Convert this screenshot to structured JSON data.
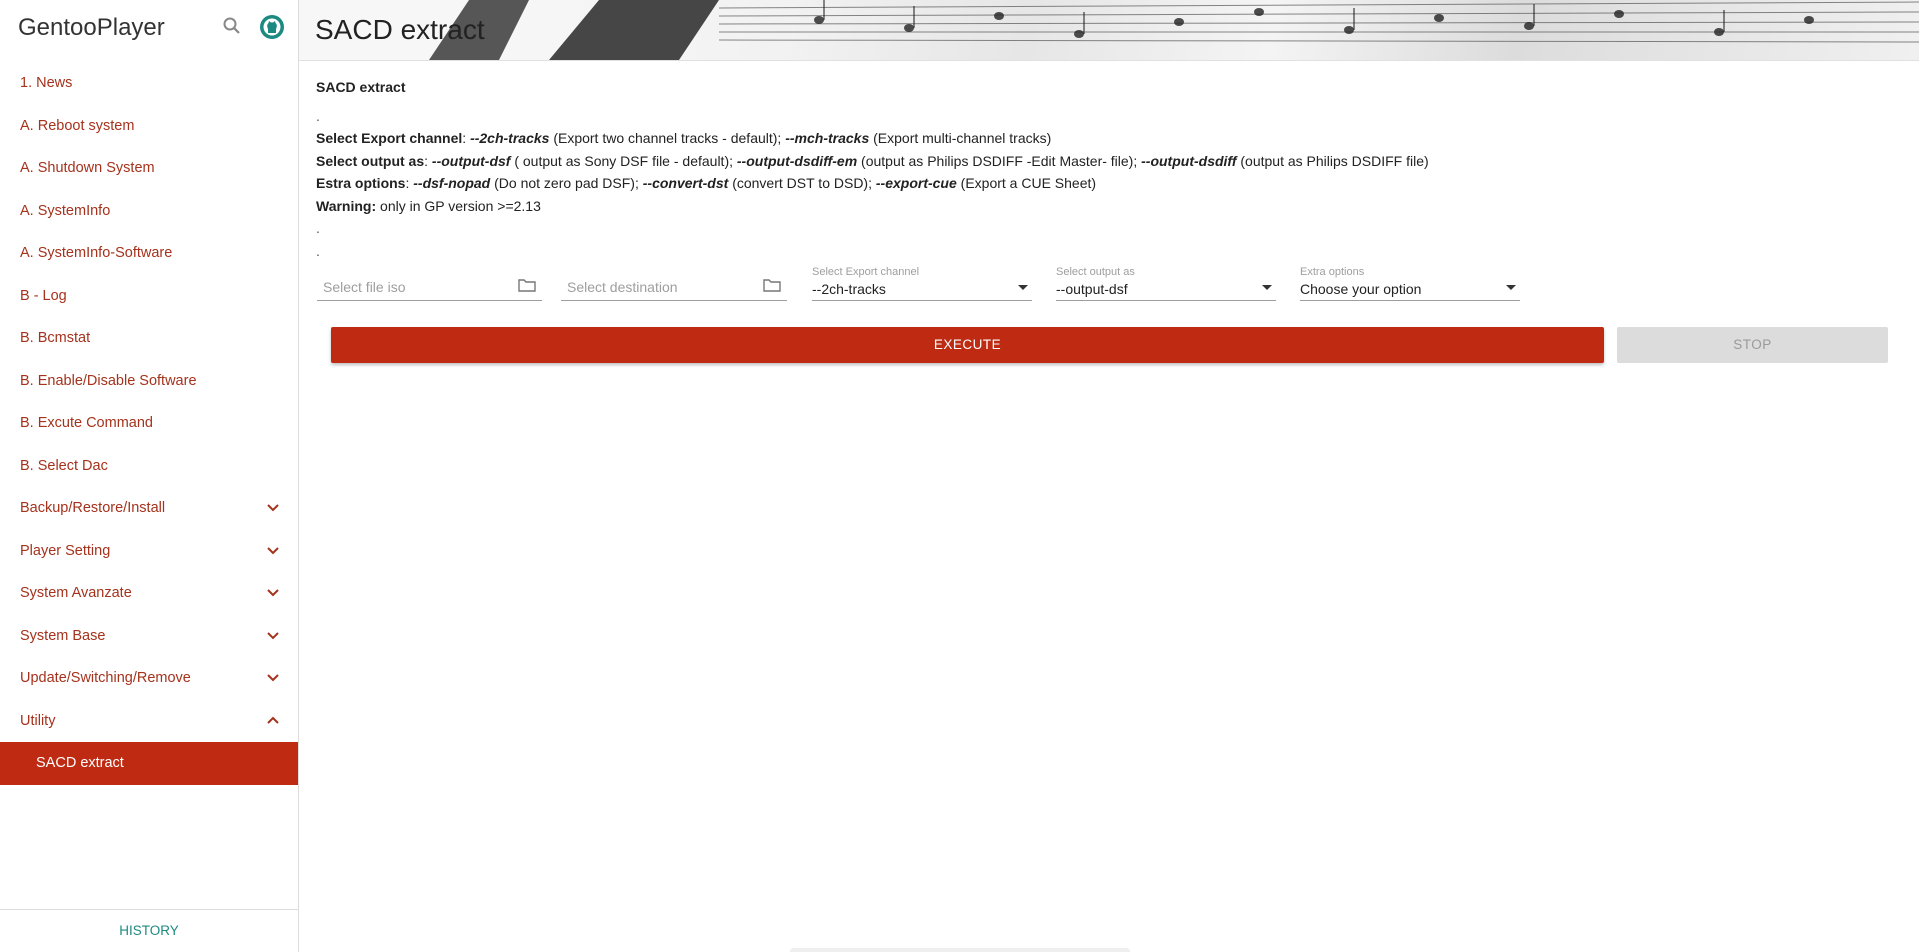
{
  "app": {
    "name": "GentooPlayer",
    "search_icon": "search-icon",
    "github_icon": "github-icon"
  },
  "sidebar": {
    "items": [
      {
        "label": "1. News"
      },
      {
        "label": "A. Reboot system"
      },
      {
        "label": "A. Shutdown System"
      },
      {
        "label": "A. SystemInfo"
      },
      {
        "label": "A. SystemInfo-Software"
      },
      {
        "label": "B - Log"
      },
      {
        "label": "B. Bcmstat"
      },
      {
        "label": "B. Enable/Disable Software"
      },
      {
        "label": "B. Excute Command"
      },
      {
        "label": "B. Select Dac"
      },
      {
        "label": "Backup/Restore/Install",
        "chevron": "chevron-down-icon"
      },
      {
        "label": "Player Setting",
        "chevron": "chevron-down-icon"
      },
      {
        "label": "System Avanzate",
        "chevron": "chevron-down-icon"
      },
      {
        "label": "System Base",
        "chevron": "chevron-down-icon"
      },
      {
        "label": "Update/Switching/Remove",
        "chevron": "chevron-down-icon"
      },
      {
        "label": "Utility",
        "chevron": "chevron-up-icon"
      },
      {
        "label": "SACD extract",
        "active": true
      }
    ],
    "footer_label": "HISTORY"
  },
  "header": {
    "title": "SACD extract"
  },
  "main": {
    "heading": "SACD extract",
    "dot": ".",
    "line1": {
      "label": "Select Export channel",
      "opt1": "--2ch-tracks",
      "desc1": " (Export two channel tracks - default); ",
      "opt2": "--mch-tracks",
      "desc2": " (Export multi-channel tracks)"
    },
    "line2": {
      "label": "Select output as",
      "opt1": "--output-dsf",
      "desc1": " ( output as Sony DSF file - default); ",
      "opt2": "--output-dsdiff-em",
      "desc2": " (output as Philips DSDIFF -Edit Master- file); ",
      "opt3": "--output-dsdiff",
      "desc3": " (output as Philips DSDIFF file)"
    },
    "line3": {
      "label": "Estra options",
      "opt1": "--dsf-nopad",
      "desc1": " (Do not zero pad DSF); ",
      "opt2": "--convert-dst",
      "desc2": " (convert DST to DSD); ",
      "opt3": "--export-cue",
      "desc3": " (Export a CUE Sheet)"
    },
    "warning": {
      "label": "Warning:",
      "text": " only in GP version >=2.13"
    },
    "form": {
      "file_iso_placeholder": "Select file iso",
      "destination_placeholder": "Select destination",
      "export_channel": {
        "label": "Select Export channel",
        "value": "--2ch-tracks"
      },
      "output_as": {
        "label": "Select output as",
        "value": "--output-dsf"
      },
      "extra_options": {
        "label": "Extra options",
        "value": "Choose your option"
      }
    },
    "execute_label": "EXECUTE",
    "stop_label": "STOP"
  },
  "colors": {
    "accent": "#bf2a12",
    "link": "#a5321c",
    "teal": "#1d8a82",
    "disabled": "#dcdcdc"
  }
}
